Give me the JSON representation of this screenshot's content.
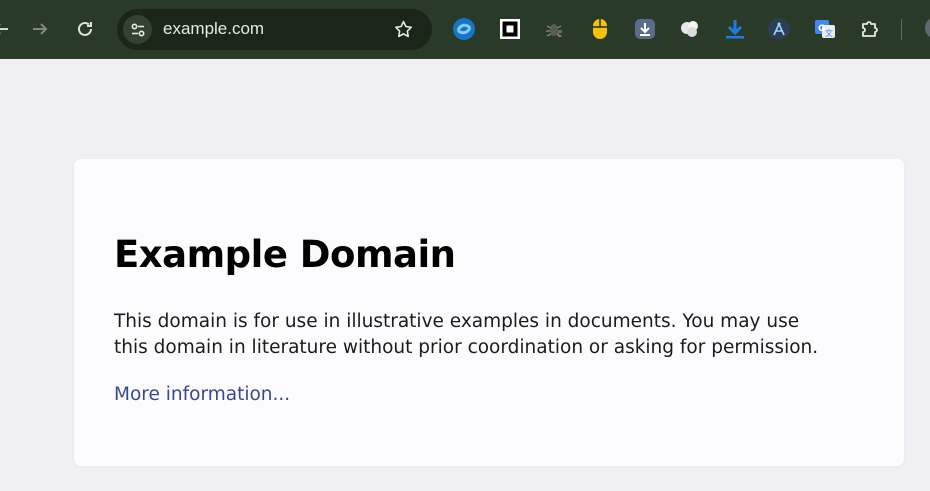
{
  "browser": {
    "url": "example.com",
    "icons": {
      "back": "arrow-left-icon",
      "forward": "arrow-right-icon",
      "reload": "reload-icon",
      "site_info": "tune-icon",
      "bookmark": "star-icon",
      "extensions_menu": "puzzle-icon"
    },
    "extensions": [
      "blue-swirl-extension-icon",
      "black-square-extension-icon",
      "bug-extension-icon",
      "yellow-mouse-extension-icon",
      "download-box-extension-icon",
      "white-blob-extension-icon",
      "blue-download-extension-icon",
      "compass-a-extension-icon",
      "google-translate-extension-icon"
    ]
  },
  "page": {
    "title": "Example Domain",
    "paragraph": "This domain is for use in illustrative examples in documents. You may use this domain in literature without prior coordination or asking for permission.",
    "link_text": "More information..."
  },
  "colors": {
    "toolbar_bg": "#2a3a28",
    "omnibox_bg": "#1a2618",
    "page_bg": "#f0f0f2",
    "card_bg": "#fcfcfe",
    "link": "#38488f"
  }
}
